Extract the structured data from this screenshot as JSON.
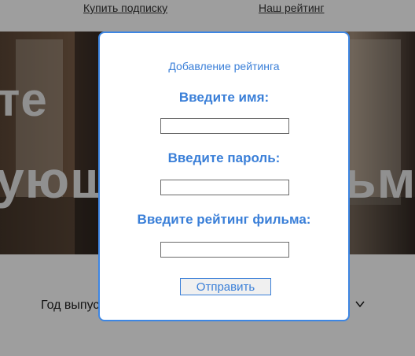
{
  "nav": {
    "subscribe_link": "Купить подписку",
    "rating_link": "Наш рейтинг"
  },
  "hero": {
    "line1": "те",
    "line2": "ующ",
    "line3": "ьм"
  },
  "filters": {
    "year_label": "Год выпус"
  },
  "modal": {
    "title": "Добавление рейтинга",
    "name_label": "Введите имя:",
    "name_value": "",
    "password_label": "Введите пароль:",
    "password_value": "",
    "rating_label": "Введите рейтинг фильма:",
    "rating_value": "",
    "submit_label": "Отправить"
  },
  "colors": {
    "accent": "#3a7fd8",
    "modal_border": "#3d86e3",
    "overlay": "rgba(0,0,0,0.38)"
  },
  "icons": {
    "dropdown": "chevron-down-icon"
  }
}
